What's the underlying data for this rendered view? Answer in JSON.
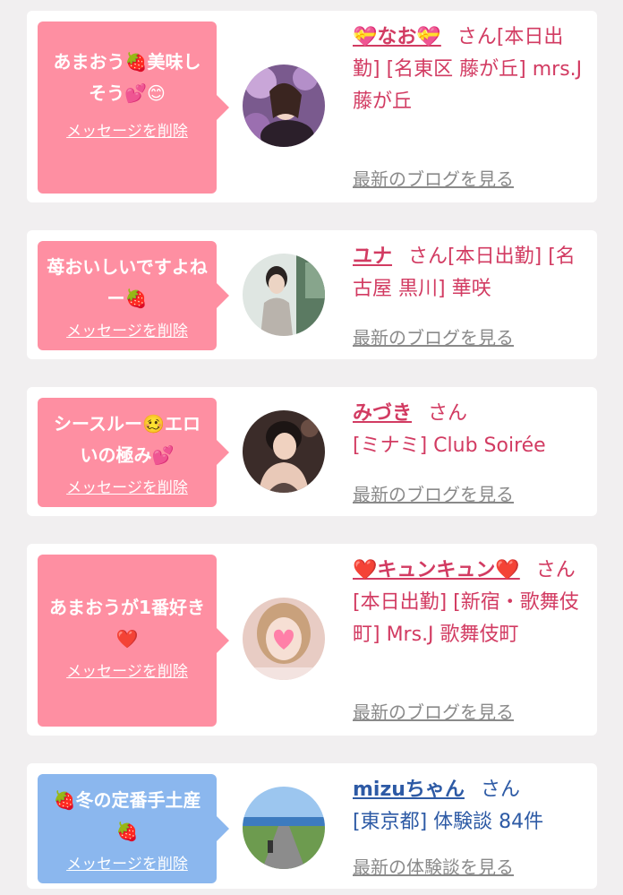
{
  "messages": [
    {
      "bubble_text": "あまおう🍓美味しそう💕😊",
      "delete_label": "メッセージを削除",
      "name": "💝なお💝",
      "honorific": "さん",
      "detail": "[本日出勤] [名東区 藤が丘] mrs.J 藤が丘",
      "link_label": "最新のブログを見る",
      "avatar_icon": "woman-photo-avatar"
    },
    {
      "bubble_text": "苺おいしいですよねー🍓",
      "delete_label": "メッセージを削除",
      "name": "ユナ",
      "honorific": "さん",
      "detail": "[本日出勤] [名古屋 黒川] 華咲",
      "link_label": "最新のブログを見る",
      "avatar_icon": "woman-photo-avatar"
    },
    {
      "bubble_text": "シースルー🥴エロいの極み💕",
      "delete_label": "メッセージを削除",
      "name": "みづき",
      "honorific": "さん",
      "detail": "[ミナミ] Club Soirée",
      "link_label": "最新のブログを見る",
      "avatar_icon": "woman-photo-avatar"
    },
    {
      "bubble_text": "あまおうが1番好き❤️",
      "delete_label": "メッセージを削除",
      "name": "❤️キュンキュン❤️",
      "honorific": "さん",
      "detail": "[本日出勤] [新宿・歌舞伎町] Mrs.J 歌舞伎町",
      "link_label": "最新のブログを見る",
      "avatar_icon": "woman-photo-avatar"
    },
    {
      "bubble_text": "🍓冬の定番手土産🍓",
      "delete_label": "メッセージを削除",
      "name": "mizuちゃん",
      "honorific": "さん",
      "detail": "[東京都] 体験談 84件",
      "link_label": "最新の体験談を見る",
      "avatar_icon": "road-landscape-avatar"
    }
  ],
  "colors": {
    "pink_bubble": "#fe8fa2",
    "blue_bubble": "#8bb7ee",
    "pink_text": "#d23b62",
    "blue_text": "#2d5aa5"
  }
}
